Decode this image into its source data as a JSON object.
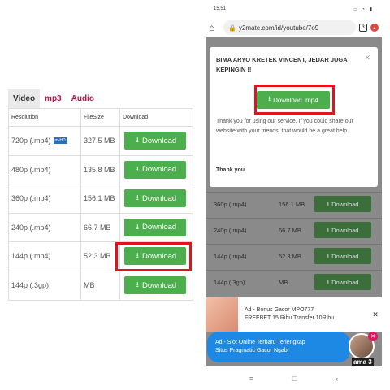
{
  "left": {
    "tabs": [
      {
        "label": "Video",
        "active": true
      },
      {
        "label": "mp3",
        "active": false
      },
      {
        "label": "Audio",
        "active": false
      }
    ],
    "headers": {
      "resolution": "Resolution",
      "filesize": "FileSize",
      "download": "Download"
    },
    "rows": [
      {
        "resolution": "720p (.mp4)",
        "badge": "m-HD",
        "size": "327.5 MB",
        "button": "Download"
      },
      {
        "resolution": "480p (.mp4)",
        "badge": "",
        "size": "135.8 MB",
        "button": "Download"
      },
      {
        "resolution": "360p (.mp4)",
        "badge": "",
        "size": "156.1 MB",
        "button": "Download"
      },
      {
        "resolution": "240p (.mp4)",
        "badge": "",
        "size": "66.7 MB",
        "button": "Download"
      },
      {
        "resolution": "144p (.mp4)",
        "badge": "",
        "size": "52.3 MB",
        "button": "Download"
      },
      {
        "resolution": "144p (.3gp)",
        "badge": "",
        "size": "MB",
        "button": "Download"
      }
    ]
  },
  "phone": {
    "time": "15.51",
    "url": "y2mate.com/id/youtube/7o9",
    "tabs_count": "3",
    "modal": {
      "title": "BIMA ARYO KRETEK VINCENT, JEDAR JUGA KEPINGIN !!",
      "button": "Download .mp4",
      "text": "Thank you for using our service. If you could share our website with your friends, that would be a great help.",
      "thanks": "Thank you."
    },
    "rows": [
      {
        "res": "360p (.mp4)",
        "size": "156.1 MB",
        "button": "Download"
      },
      {
        "res": "240p (.mp4)",
        "size": "66.7 MB",
        "button": "Download"
      },
      {
        "res": "144p (.mp4)",
        "size": "52.3 MB",
        "button": "Download"
      },
      {
        "res": "144p (.3gp)",
        "size": "MB",
        "button": "Download"
      }
    ],
    "ad1": {
      "line1": "Ad - Bonus Gacor MPO777",
      "line2": "FREEBET 15 Ribu Transfer 10Ribu"
    },
    "ad2": {
      "line1": "Ad - Slot Online Terbaru Terlengkap",
      "line2": "Situs Pragmatic Gacor Ngab!"
    },
    "bottom_label": "ama 3",
    "nav": {
      "menu": "≡",
      "home": "□",
      "back": "‹"
    }
  }
}
